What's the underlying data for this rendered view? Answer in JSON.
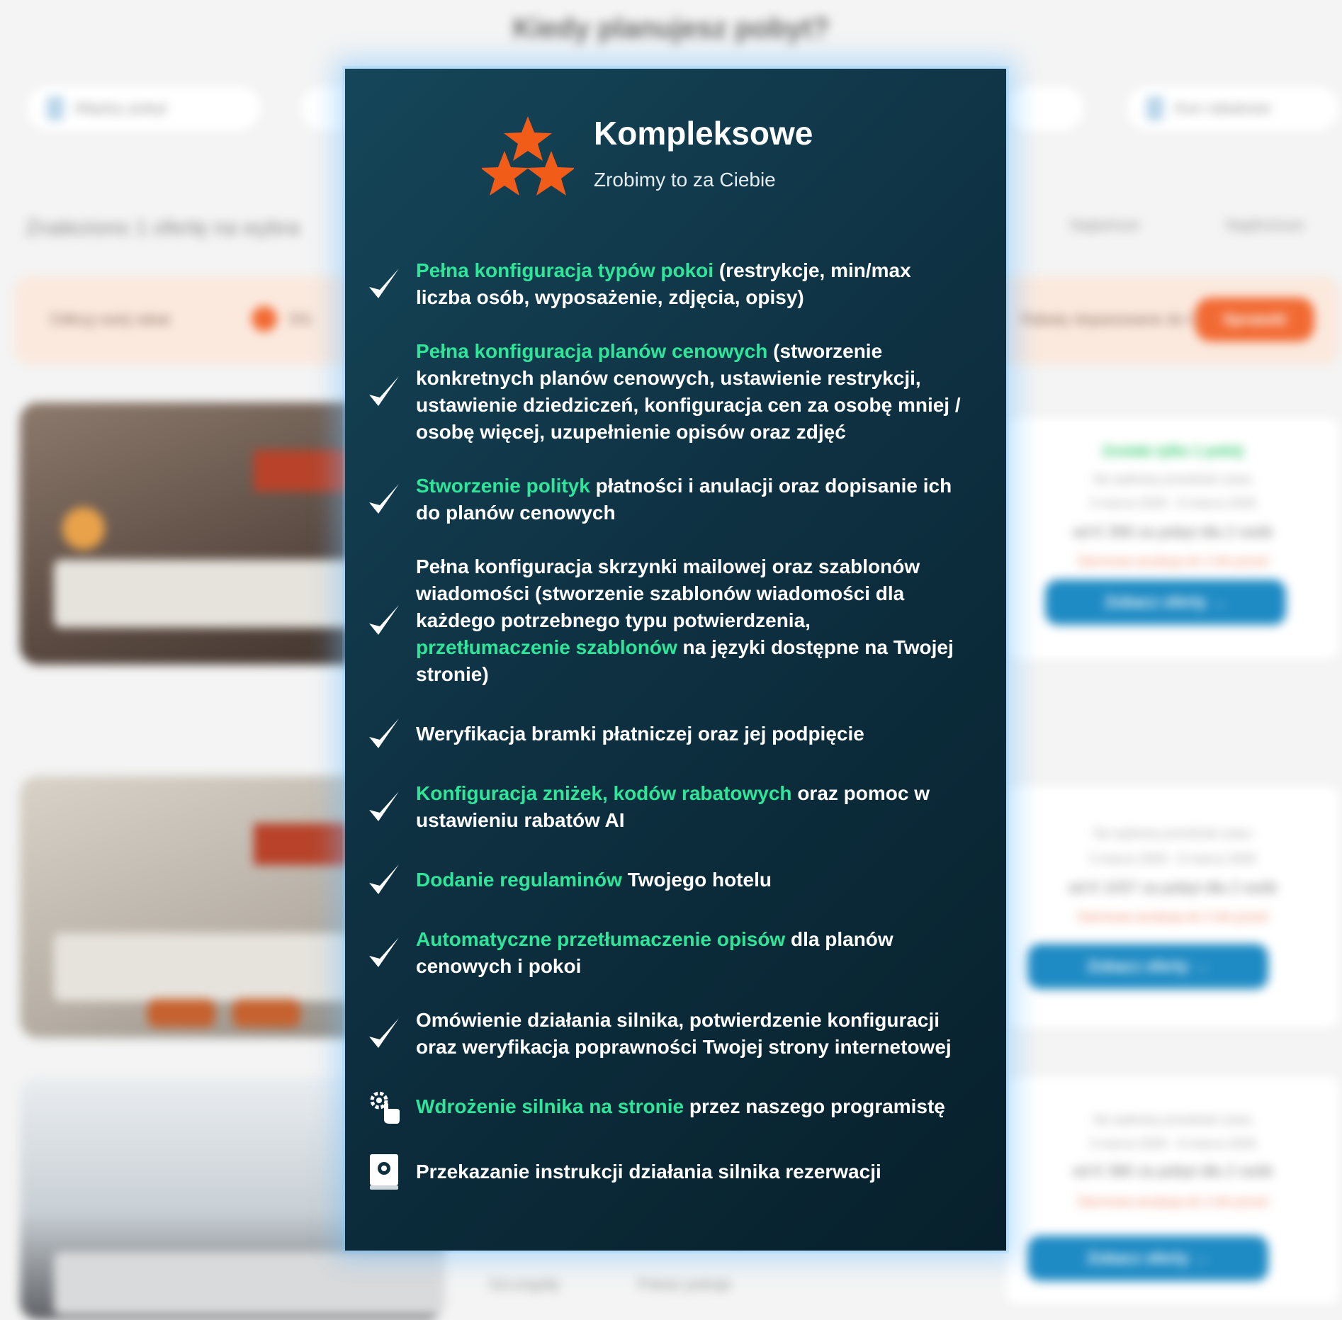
{
  "background": {
    "heading": "Kiedy planujesz pobyt?",
    "date_from_label": "Między pobyt",
    "date_to_label": "Kon rabatowe",
    "results_text": "Znaleziono 1 ofertę na wybra",
    "sort_options": [
      "Najtańsze",
      "Najdroższe"
    ],
    "banner": {
      "left_text": "Odkryj swój rabat",
      "mid_text": "5%",
      "right_text": "Rabaty dopasowane do Ciebie",
      "button_label": "Sprawdź"
    },
    "offers": [
      {
        "availability": "Zostało tylko 1 pokój",
        "line1": "Na wybrany przedział czasu",
        "dates": "3 marca 2026 - 8 marca 2026",
        "price": "od € 399 za pobyt dla 2 osób",
        "warning": "Darmowa anulacja do 3 dni przed",
        "cta_label": "Zobacz oferty →"
      },
      {
        "availability": "",
        "line1": "Na wybrany przedział czasu",
        "dates": "3 marca 2026 - 8 marca 2026",
        "price": "od € 1037 za pobyt dla 2 osób",
        "warning": "Darmowa anulacja do 3 dni przed",
        "cta_label": "Zobacz oferty →"
      },
      {
        "availability": "",
        "line1": "Na wybrany przedział czasu",
        "dates": "3 marca 2026 - 8 marca 2026",
        "price": "od € 380 za pobyt dla 2 osób",
        "warning": "Darmowa anulacja do 3 dni przed",
        "cta_label": "Zobacz oferty →"
      }
    ],
    "bottom_links": [
      "Szczegóły",
      "Pokaż pokoje"
    ]
  },
  "modal": {
    "title": "Kompleksowe",
    "subtitle": "Zrobimy to za Ciebie",
    "accent_color": "#2ee69a",
    "star_color": "#f25c19",
    "items": [
      {
        "icon": "checkmark-icon",
        "highlight": "Pełna konfiguracja typów pokoi",
        "rest": " (restrykcje, min/max liczba osób, wyposażenie, zdjęcia, opisy)"
      },
      {
        "icon": "checkmark-icon",
        "highlight": "Pełna konfiguracja planów cenowych",
        "rest": " (stworzenie konkretnych planów cenowych, ustawienie restrykcji, ustawienie dziedziczeń, konfiguracja cen za osobę mniej / osobę więcej, uzupełnienie opisów oraz zdjęć"
      },
      {
        "icon": "checkmark-icon",
        "highlight": "Stworzenie polityk",
        "rest": " płatności i anulacji oraz dopisanie ich do planów cenowych"
      },
      {
        "icon": "checkmark-icon",
        "pre": "Pełna konfiguracja skrzynki mailowej oraz szablonów wiadomości (stworzenie szablonów wiadomości dla każdego potrzebnego typu potwierdzenia, ",
        "highlight": "przetłumaczenie szablonów",
        "rest": " na języki dostępne na Twojej stronie)"
      },
      {
        "icon": "checkmark-icon",
        "highlight": "",
        "rest": "Weryfikacja bramki płatniczej oraz jej podpięcie"
      },
      {
        "icon": "checkmark-icon",
        "highlight": "Konfiguracja zniżek, kodów rabatowych",
        "rest": " oraz pomoc w ustawieniu rabatów AI"
      },
      {
        "icon": "checkmark-icon",
        "highlight": "Dodanie regulaminów",
        "rest": " Twojego hotelu"
      },
      {
        "icon": "checkmark-icon",
        "highlight": "Automatyczne przetłumaczenie opisów",
        "rest": " dla planów cenowych i pokoi"
      },
      {
        "icon": "checkmark-icon",
        "highlight": "",
        "rest": "Omówienie działania silnika, potwierdzenie konfiguracji oraz weryfikacja poprawności Twojej strony internetowej"
      },
      {
        "icon": "gear-hand-icon",
        "highlight": "Wdrożenie silnika na stronie",
        "rest": " przez naszego programistę"
      },
      {
        "icon": "manual-book-icon",
        "highlight": "",
        "rest": "Przekazanie instrukcji działania silnika rezerwacji"
      }
    ]
  }
}
